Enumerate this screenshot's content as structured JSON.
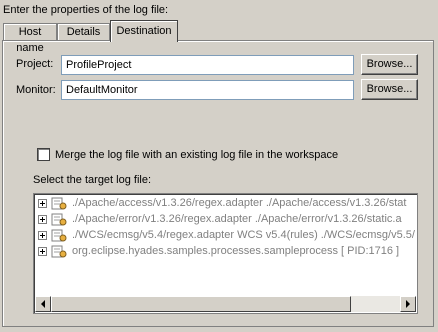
{
  "header": {
    "instruction": "Enter the properties of the log file:"
  },
  "tabs": [
    {
      "label": "Host name",
      "active": false
    },
    {
      "label": "Details",
      "active": false
    },
    {
      "label": "Destination",
      "active": true
    }
  ],
  "destination": {
    "project": {
      "label": "Project:",
      "value": "ProfileProject",
      "button": "Browse..."
    },
    "monitor": {
      "label": "Monitor:",
      "value": "DefaultMonitor",
      "button": "Browse..."
    },
    "merge": {
      "label": "Merge the log file with an existing log file in the workspace",
      "checked": false
    },
    "target": {
      "label": "Select the target log file:",
      "items": [
        "./Apache/access/v1.3.26/regex.adapter ./Apache/access/v1.3.26/stat",
        "./Apache/error/v1.3.26/regex.adapter ./Apache/error/v1.3.26/static.a",
        "./WCS/ecmsg/v5.4/regex.adapter WCS v5.4(rules) ./WCS/ecmsg/v5.5/",
        "org.eclipse.hyades.samples.processes.sampleprocess [ PID:1716 ]"
      ]
    }
  },
  "icons": {
    "expander": "plus-expander-icon",
    "log": "log-file-icon",
    "scroll_left": "arrow-left-icon",
    "scroll_right": "arrow-right-icon"
  }
}
